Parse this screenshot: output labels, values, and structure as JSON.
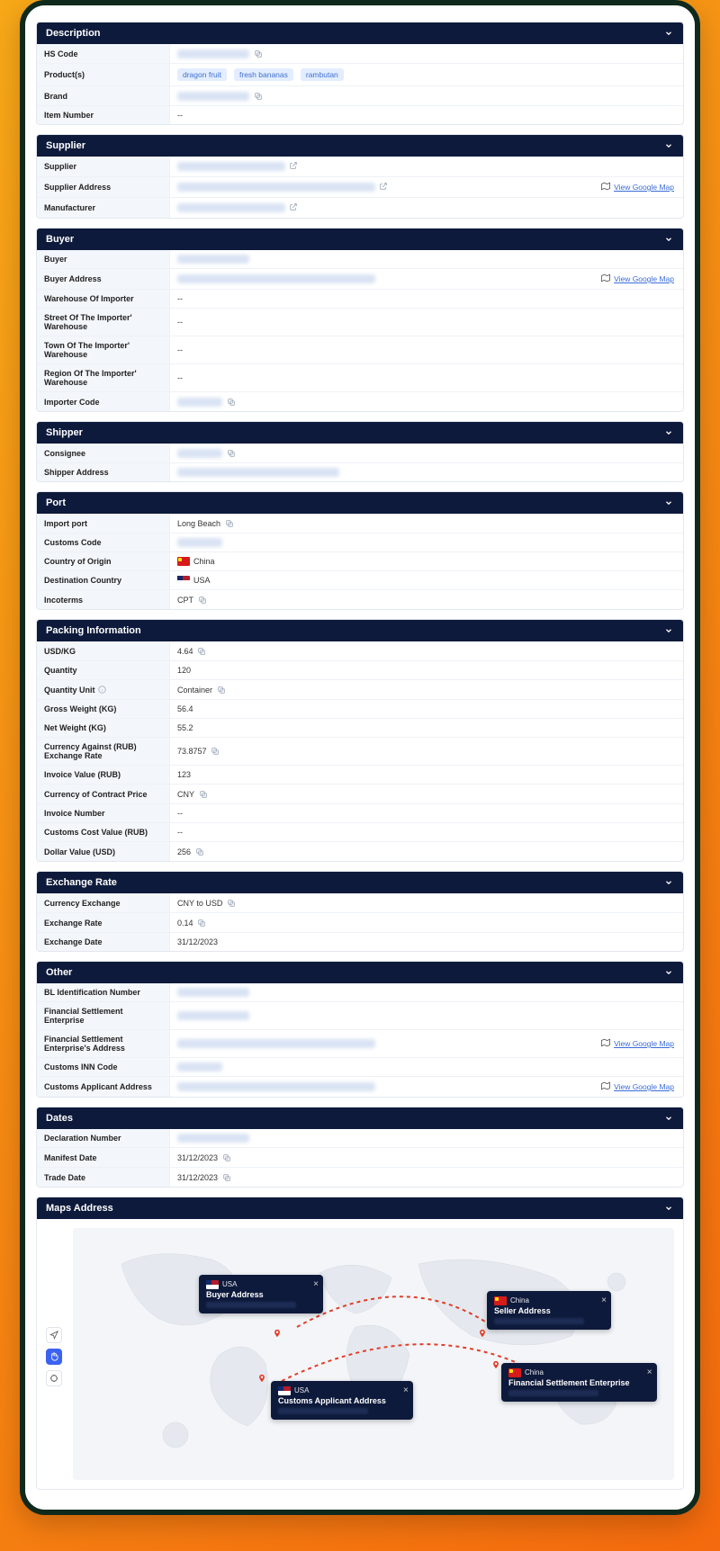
{
  "common": {
    "view_google_map": "View Google Map",
    "dash": "--"
  },
  "sections": {
    "description": {
      "title": "Description",
      "hs_code": "HS Code",
      "products_label": "Product(s)",
      "products": [
        "dragon fruit",
        "fresh bananas",
        "rambutan"
      ],
      "brand": "Brand",
      "item_number": "Item Number"
    },
    "supplier": {
      "title": "Supplier",
      "supplier": "Supplier",
      "supplier_address": "Supplier Address",
      "manufacturer": "Manufacturer"
    },
    "buyer": {
      "title": "Buyer",
      "buyer": "Buyer",
      "buyer_address": "Buyer Address",
      "warehouse_importer": "Warehouse Of Importer",
      "street_importer_wh": "Street Of The Importer' Warehouse",
      "town_importer_wh": "Town Of The Importer' Warehouse",
      "region_importer_wh": "Region Of The Importer' Warehouse",
      "importer_code": "Importer Code"
    },
    "shipper": {
      "title": "Shipper",
      "consignee": "Consignee",
      "shipper_address": "Shipper Address"
    },
    "port": {
      "title": "Port",
      "import_port": "Import port",
      "import_port_val": "Long Beach",
      "customs_code": "Customs Code",
      "country_origin": "Country of Origin",
      "country_origin_val": "China",
      "destination_country": "Destination Country",
      "destination_country_val": "USA",
      "incoterms": "Incoterms",
      "incoterms_val": "CPT"
    },
    "packing": {
      "title": "Packing Information",
      "usd_kg": "USD/KG",
      "usd_kg_val": "4.64",
      "quantity": "Quantity",
      "quantity_val": "120",
      "quantity_unit": "Quantity Unit",
      "quantity_unit_val": "Container",
      "gross_weight": "Gross Weight (KG)",
      "gross_weight_val": "56.4",
      "net_weight": "Net Weight (KG)",
      "net_weight_val": "55.2",
      "currency_rub_rate": "Currency Against (RUB) Exchange Rate",
      "currency_rub_rate_val": "73.8757",
      "invoice_value": "Invoice Value (RUB)",
      "invoice_value_val": "123",
      "currency_contract": "Currency of Contract Price",
      "currency_contract_val": "CNY",
      "invoice_number": "Invoice Number",
      "customs_cost": "Customs Cost Value (RUB)",
      "dollar_value": "Dollar Value (USD)",
      "dollar_value_val": "256"
    },
    "exchange": {
      "title": "Exchange Rate",
      "currency_exchange": "Currency Exchange",
      "currency_exchange_val": "CNY to USD",
      "exchange_rate": "Exchange Rate",
      "exchange_rate_val": "0.14",
      "exchange_date": "Exchange Date",
      "exchange_date_val": "31/12/2023"
    },
    "other": {
      "title": "Other",
      "bl_id": "BL Identification Number",
      "fse": "Financial Settlement Enterprise",
      "fse_address": "Financial Settlement Enterprise's Address",
      "customs_inn": "Customs INN Code",
      "customs_applicant_address": "Customs Applicant Address"
    },
    "dates": {
      "title": "Dates",
      "declaration_number": "Declaration Number",
      "manifest_date": "Manifest Date",
      "manifest_date_val": "31/12/2023",
      "trade_date": "Trade Date",
      "trade_date_val": "31/12/2023"
    },
    "maps": {
      "title": "Maps Address",
      "cards": {
        "buyer_country": "USA",
        "buyer_title": "Buyer Address",
        "seller_country": "China",
        "seller_title": "Seller Address",
        "customs_country": "USA",
        "customs_title": "Customs Applicant Address",
        "fse_country": "China",
        "fse_title": "Financial Settlement Enterprise"
      }
    }
  }
}
